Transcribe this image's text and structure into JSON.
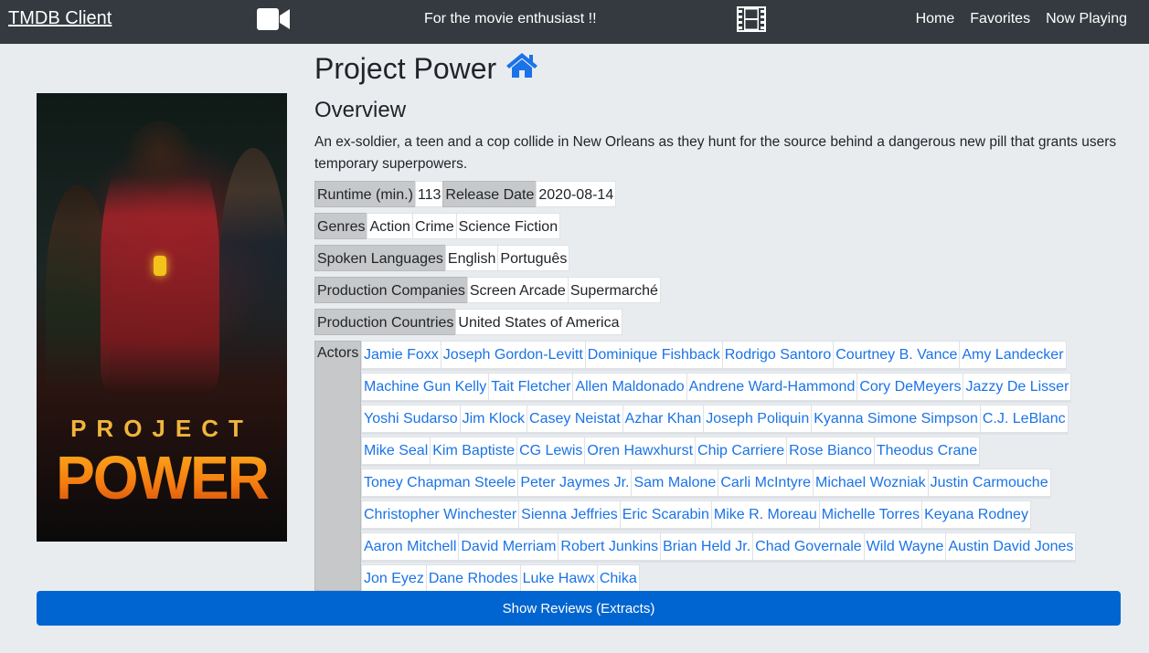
{
  "navbar": {
    "brand": "TMDB Client",
    "tagline": "For the movie enthusiast !!",
    "links": [
      "Home",
      "Favorites",
      "Now Playing"
    ]
  },
  "poster": {
    "title_top": "PROJECT",
    "title_bottom": "POWER"
  },
  "movie": {
    "title": "Project Power",
    "overview_heading": "Overview",
    "overview": "An ex-soldier, a teen and a cop collide in New Orleans as they hunt for the source behind a dangerous new pill that grants users temporary superpowers.",
    "runtime_label": "Runtime (min.)",
    "runtime": "113",
    "release_label": "Release Date",
    "release_date": "2020-08-14",
    "genres_label": "Genres",
    "genres": [
      "Action",
      "Crime",
      "Science Fiction"
    ],
    "languages_label": "Spoken Languages",
    "languages": [
      "English",
      "Português"
    ],
    "companies_label": "Production Companies",
    "companies": [
      "Screen Arcade",
      "Supermarché"
    ],
    "countries_label": "Production Countries",
    "countries": [
      "United States of America"
    ],
    "actors_label": "Actors",
    "actors": [
      "Jamie Foxx",
      "Joseph Gordon-Levitt",
      "Dominique Fishback",
      "Rodrigo Santoro",
      "Courtney B. Vance",
      "Amy Landecker",
      "Machine Gun Kelly",
      "Tait Fletcher",
      "Allen Maldonado",
      "Andrene Ward-Hammond",
      "Cory DeMeyers",
      "Jazzy De Lisser",
      "Yoshi Sudarso",
      "Jim Klock",
      "Casey Neistat",
      "Azhar Khan",
      "Joseph Poliquin",
      "Kyanna Simone Simpson",
      "C.J. LeBlanc",
      "Mike Seal",
      "Kim Baptiste",
      "CG Lewis",
      "Oren Hawxhurst",
      "Chip Carriere",
      "Rose Bianco",
      "Theodus Crane",
      "Toney Chapman Steele",
      "Peter Jaymes Jr.",
      "Sam Malone",
      "Carli McIntyre",
      "Michael Wozniak",
      "Justin Carmouche",
      "Christopher Winchester",
      "Sienna Jeffries",
      "Eric Scarabin",
      "Mike R. Moreau",
      "Michelle Torres",
      "Keyana Rodney",
      "Aaron Mitchell",
      "David Merriam",
      "Robert Junkins",
      "Brian Held Jr.",
      "Chad Governale",
      "Wild Wayne",
      "Austin David Jones",
      "Jon Eyez",
      "Dane Rhodes",
      "Luke Hawx",
      "Chika"
    ]
  },
  "reviews_button": "Show Reviews (Extracts)",
  "colors": {
    "navbar": "#343a40",
    "background": "#e9ecef",
    "link": "#1a73e8",
    "button": "#0065d1",
    "chip_label": "#c6c8ca"
  }
}
